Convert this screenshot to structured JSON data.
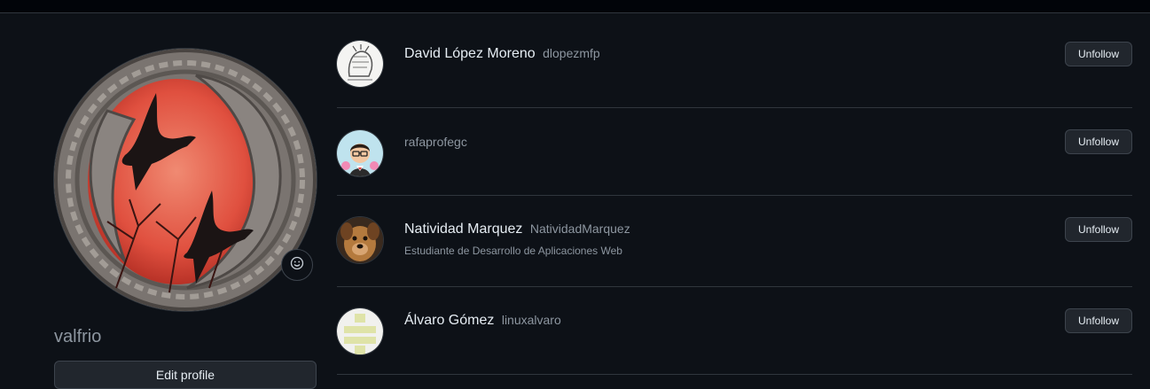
{
  "profile": {
    "username": "valfrio",
    "edit_profile_label": "Edit profile",
    "status_icon": "smiley-icon"
  },
  "following": [
    {
      "display_name": "David López Moreno",
      "login": "dlopezmfp",
      "bio": "",
      "button_label": "Unfollow"
    },
    {
      "display_name": "",
      "login": "rafaprofegc",
      "bio": "",
      "button_label": "Unfollow"
    },
    {
      "display_name": "Natividad Marquez",
      "login": "NatividadMarquez",
      "bio": "Estudiante de Desarrollo de Aplicaciones Web",
      "button_label": "Unfollow"
    },
    {
      "display_name": "Álvaro Gómez",
      "login": "linuxalvaro",
      "bio": "",
      "button_label": "Unfollow"
    }
  ],
  "colors": {
    "background": "#0d1117",
    "border": "#30363d",
    "button_bg": "#21262d",
    "muted_text": "#8d96a0"
  }
}
